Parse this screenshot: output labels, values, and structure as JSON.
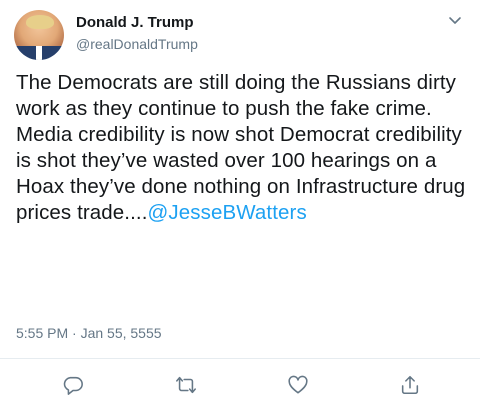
{
  "tweet": {
    "author_name": "Donald J. Trump",
    "author_handle": "@realDonaldTrump",
    "text_before_mention": "The Democrats are still doing the Russians dirty work as they continue to push the fake crime. Media credibility is now shot Democrat credibility is shot they’ve wasted over 100 hearings on a Hoax they’ve done nothing on Infrastructure drug prices trade....",
    "mention": "@JesseBWatters",
    "timestamp": "5:55 PM · Jan 55, 5555"
  },
  "icons": {
    "menu": "chevron-down-icon",
    "reply": "reply-icon",
    "retweet": "retweet-icon",
    "like": "heart-icon",
    "share": "share-icon"
  },
  "colors": {
    "text": "#14171a",
    "secondary": "#657786",
    "mention": "#1da1f2",
    "divider": "#e6ecf0"
  }
}
